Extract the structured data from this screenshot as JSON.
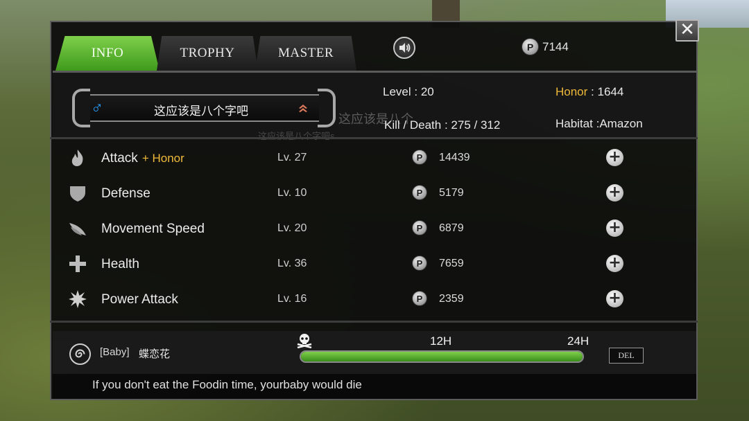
{
  "tabs": [
    {
      "label": "INFO",
      "active": true
    },
    {
      "label": "TROPHY",
      "active": false
    },
    {
      "label": "MASTER",
      "active": false
    }
  ],
  "header": {
    "sound_icon": "speaker-icon",
    "coin_symbol": "P",
    "coin_total": "7144"
  },
  "profile": {
    "gender_symbol": "♂",
    "name": "这应该是八个字吧",
    "ghost_name": "这应该是八个",
    "ghost_name_small": "这应该是八个字吧s",
    "level_label": "Level",
    "level_value": "20",
    "honor_label": "Honor",
    "honor_value": "1644",
    "kd_label": "Kill / Death",
    "kd_value": "275 / 312",
    "habitat_label": "Habitat",
    "habitat_value": "Amazon",
    "separator": ":"
  },
  "skills": [
    {
      "icon": "flame-icon",
      "name": "Attack",
      "extra": "+ Honor",
      "level": "Lv. 27",
      "cost": "14439"
    },
    {
      "icon": "shield-icon",
      "name": "Defense",
      "extra": "",
      "level": "Lv. 10",
      "cost": "5179"
    },
    {
      "icon": "wing-icon",
      "name": "Movement Speed",
      "extra": "",
      "level": "Lv. 20",
      "cost": "6879"
    },
    {
      "icon": "cross-icon",
      "name": "Health",
      "extra": "",
      "level": "Lv. 36",
      "cost": "7659"
    },
    {
      "icon": "burst-icon",
      "name": "Power Attack",
      "extra": "",
      "level": "Lv. 16",
      "cost": "2359"
    }
  ],
  "upgrade_symbol": "+",
  "baby": {
    "tag": "[Baby]",
    "name": "蝶恋花",
    "mark_12": "12H",
    "mark_24": "24H",
    "hunger_fraction": 1.0,
    "del_label": "DEL"
  },
  "footer": {
    "message": "If you don't eat the Foodin time, yourbaby would die"
  },
  "close_symbol": "✕",
  "colors": {
    "accent_green": "#5fb832",
    "honor_gold": "#f0b93a",
    "gender_blue": "#2aa0ff"
  }
}
